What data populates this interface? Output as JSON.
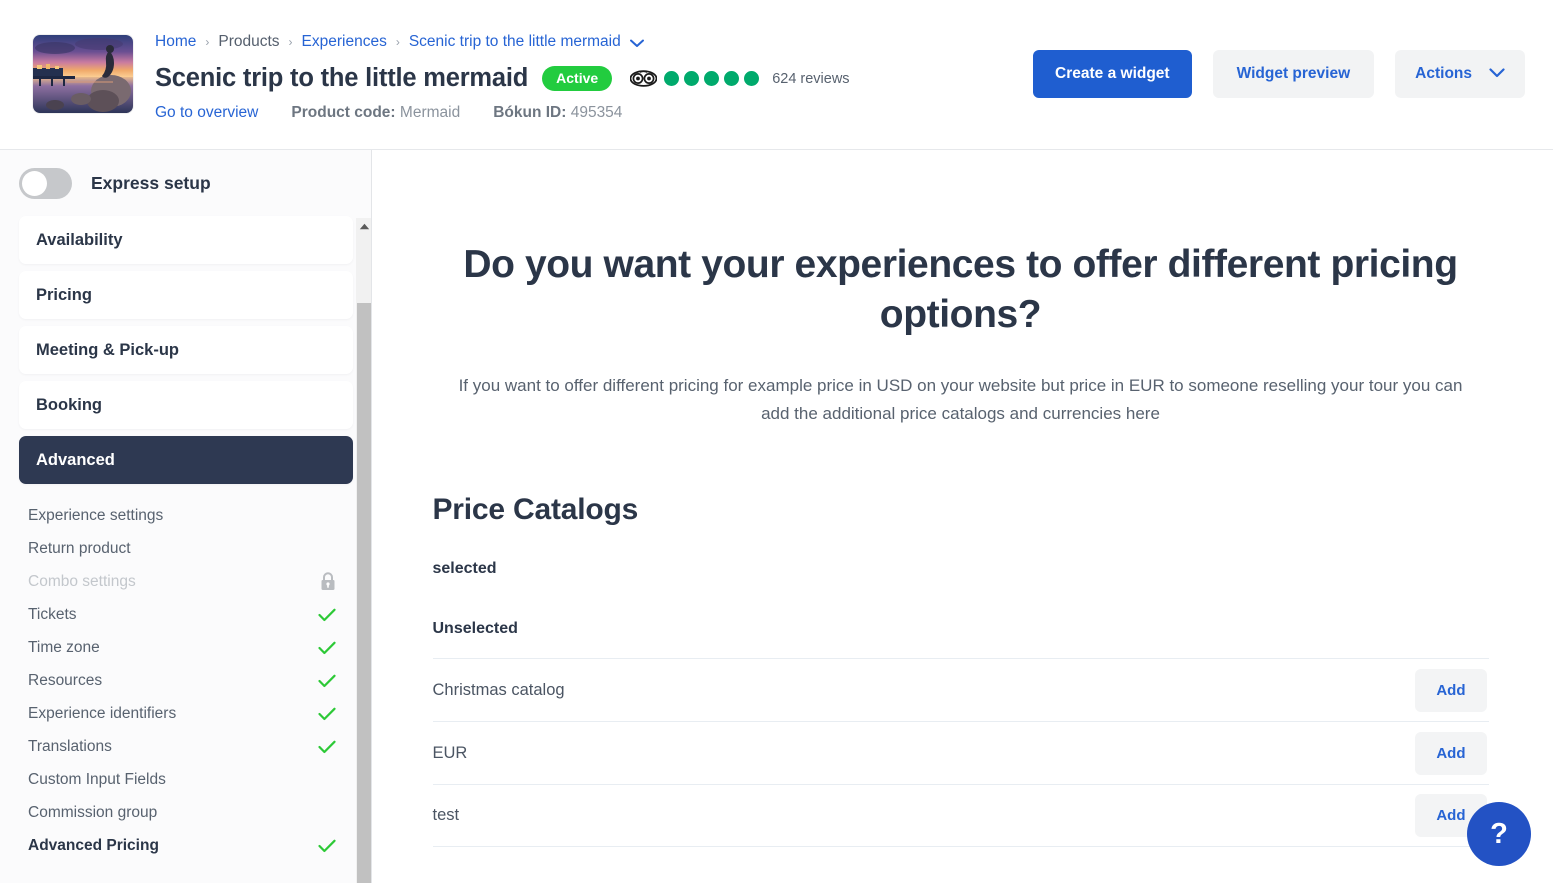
{
  "header": {
    "thumbnail_alt": "Scenic sunset over water with mermaid statue on rocks",
    "breadcrumb": [
      {
        "label": "Home",
        "type": "link"
      },
      {
        "label": "Products",
        "type": "static"
      },
      {
        "label": "Experiences",
        "type": "link"
      },
      {
        "label": "Scenic trip to the little mermaid",
        "type": "link",
        "caret": true
      }
    ],
    "breadcrumb_separator": "›",
    "title": "Scenic trip to the little mermaid",
    "status_badge": "Active",
    "rating_dots": 5,
    "review_count": "624 reviews",
    "overview_link": "Go to overview",
    "product_code_label": "Product code:",
    "product_code_value": "Mermaid",
    "bokun_id_label": "Bókun ID:",
    "bokun_id_value": "495354",
    "actions": {
      "create_widget": "Create a widget",
      "widget_preview": "Widget preview",
      "actions_menu": "Actions"
    },
    "colors": {
      "primary_blue": "#1f5ed0",
      "link_blue": "#2764d4",
      "active_green": "#22cc3f",
      "tripadvisor_green": "#00aa6c"
    }
  },
  "sidebar": {
    "express_setup_label": "Express setup",
    "express_setup_on": false,
    "nav_cards": [
      {
        "label": "Availability",
        "active": false
      },
      {
        "label": "Pricing",
        "active": false
      },
      {
        "label": "Meeting & Pick-up",
        "active": false
      },
      {
        "label": "Booking",
        "active": false
      },
      {
        "label": "Advanced",
        "active": true
      }
    ],
    "sub_items": [
      {
        "label": "Experience settings",
        "state": "normal",
        "icon": "none"
      },
      {
        "label": "Return product",
        "state": "normal",
        "icon": "none"
      },
      {
        "label": "Combo settings",
        "state": "disabled",
        "icon": "lock"
      },
      {
        "label": "Tickets",
        "state": "normal",
        "icon": "check"
      },
      {
        "label": "Time zone",
        "state": "normal",
        "icon": "check"
      },
      {
        "label": "Resources",
        "state": "normal",
        "icon": "check"
      },
      {
        "label": "Experience identifiers",
        "state": "normal",
        "icon": "check"
      },
      {
        "label": "Translations",
        "state": "normal",
        "icon": "check"
      },
      {
        "label": "Custom Input Fields",
        "state": "normal",
        "icon": "none"
      },
      {
        "label": "Commission group",
        "state": "normal",
        "icon": "none"
      },
      {
        "label": "Advanced Pricing",
        "state": "bold",
        "icon": "check"
      }
    ],
    "colors": {
      "active_nav_bg": "#2e3952",
      "check_green": "#2dc937"
    }
  },
  "main": {
    "heading": "Do you want your experiences to offer different pricing options?",
    "subheading": "If you want to offer different pricing for example price in USD on your website but price in EUR to someone reselling your tour you can add the additional price catalogs and currencies here",
    "section_title": "Price Catalogs",
    "selected_group_label": "selected",
    "unselected_group_label": "Unselected",
    "selected_catalogs": [],
    "unselected_catalogs": [
      {
        "name": "Christmas catalog",
        "action": "Add"
      },
      {
        "name": "EUR",
        "action": "Add"
      },
      {
        "name": "test",
        "action": "Add"
      }
    ],
    "help_button_glyph": "?"
  }
}
